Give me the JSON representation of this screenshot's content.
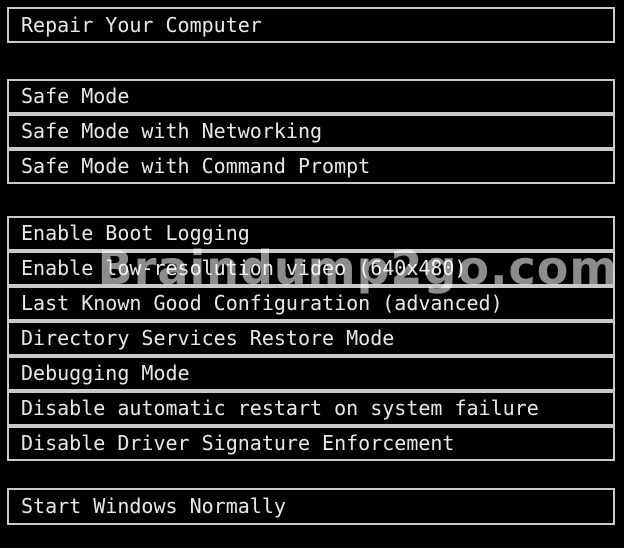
{
  "menu": {
    "repair": "Repair Your Computer",
    "safe_mode": "Safe Mode",
    "safe_mode_networking": "Safe Mode with Networking",
    "safe_mode_cmd": "Safe Mode with Command Prompt",
    "boot_logging": "Enable Boot Logging",
    "low_res_video": "Enable low-resolution video (640x480)",
    "last_known_good": "Last Known Good Configuration (advanced)",
    "ds_restore": "Directory Services Restore Mode",
    "debugging": "Debugging Mode",
    "disable_restart": "Disable automatic restart on system failure",
    "disable_driver_sig": "Disable Driver Signature Enforcement",
    "start_normally": "Start Windows Normally"
  },
  "watermark": "Braindump2go.com",
  "colors": {
    "background": "#000000",
    "text": "#e8e8e8",
    "border": "#c9c9c9"
  }
}
